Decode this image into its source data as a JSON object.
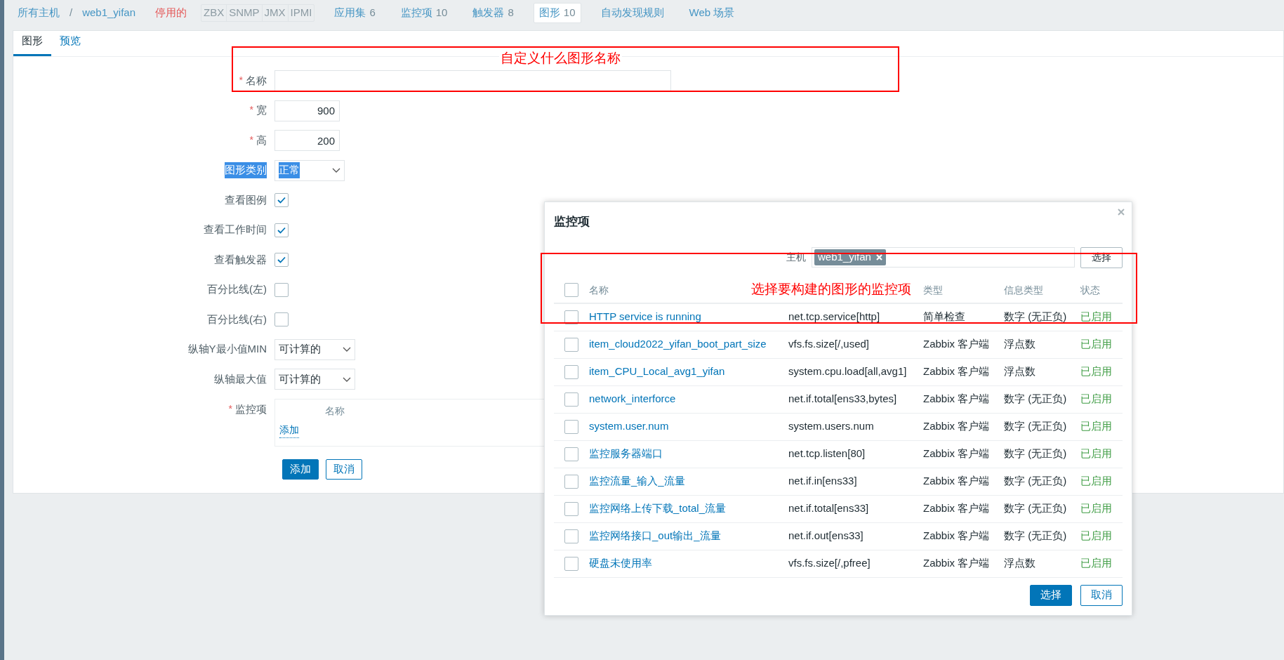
{
  "breadcrumb": {
    "host_list": "所有主机",
    "separator": "/",
    "host": "web1_yifan"
  },
  "host_status": "停用的",
  "availability": [
    "ZBX",
    "SNMP",
    "JMX",
    "IPMI"
  ],
  "nav_tabs": [
    {
      "label": "应用集",
      "count": "6",
      "selected": false
    },
    {
      "label": "监控项",
      "count": "10",
      "selected": false
    },
    {
      "label": "触发器",
      "count": "8",
      "selected": false
    },
    {
      "label": "图形",
      "count": "10",
      "selected": true
    },
    {
      "label": "自动发现规则",
      "selected": false
    },
    {
      "label": "Web 场景",
      "selected": false
    }
  ],
  "subtabs": [
    {
      "label": "图形",
      "selected": true
    },
    {
      "label": "预览",
      "selected": false
    }
  ],
  "form": {
    "required_mark": "*",
    "fields": [
      {
        "kind": "text",
        "label": "名称",
        "required": true
      },
      {
        "kind": "number",
        "label": "宽",
        "required": true,
        "value": "900"
      },
      {
        "kind": "number",
        "label": "高",
        "required": true,
        "value": "200"
      },
      {
        "kind": "select",
        "label": "图形类别",
        "value": "正常",
        "highlighted": true
      },
      {
        "kind": "checkbox",
        "label": "查看图例",
        "checked": true
      },
      {
        "kind": "checkbox",
        "label": "查看工作时间",
        "checked": true
      },
      {
        "kind": "checkbox",
        "label": "查看触发器",
        "checked": true
      },
      {
        "kind": "checkbox",
        "label": "百分比线(左)",
        "checked": false
      },
      {
        "kind": "checkbox",
        "label": "百分比线(右)",
        "checked": false
      },
      {
        "kind": "select",
        "label": "纵轴Y最小值MIN",
        "value": "可计算的",
        "highlighted": false
      },
      {
        "kind": "select",
        "label": "纵轴最大值",
        "value": "可计算的",
        "highlighted": false
      },
      {
        "kind": "items",
        "label": "监控项",
        "required": true,
        "column": "名称",
        "link": "添加"
      }
    ],
    "buttons": [
      {
        "label": "添加",
        "kind": "primary"
      },
      {
        "label": "取消",
        "kind": "secondary"
      }
    ]
  },
  "dialog": {
    "title": "监控项",
    "host_label": "主机",
    "host_tag": "web1_yifan",
    "select_button": "选择",
    "select_all": {
      "checked": false
    },
    "header": {
      "name": "名称",
      "type": "类型",
      "info_type": "信息类型",
      "status": "状态"
    },
    "rows": [
      {
        "name": "HTTP service is running",
        "key": "net.tcp.service[http]",
        "type": "简单检查",
        "info_type": "数字 (无正负)",
        "status": "已启用",
        "checked": false
      },
      {
        "name": "item_cloud2022_yifan_boot_part_size",
        "key": "vfs.fs.size[/,used]",
        "type": "Zabbix 客户端",
        "info_type": "浮点数",
        "status": "已启用",
        "checked": false
      },
      {
        "name": "item_CPU_Local_avg1_yifan",
        "key": "system.cpu.load[all,avg1]",
        "type": "Zabbix 客户端",
        "info_type": "浮点数",
        "status": "已启用",
        "checked": false
      },
      {
        "name": "network_interforce",
        "key": "net.if.total[ens33,bytes]",
        "type": "Zabbix 客户端",
        "info_type": "数字 (无正负)",
        "status": "已启用",
        "checked": false
      },
      {
        "name": "system.user.num",
        "key": "system.users.num",
        "type": "Zabbix 客户端",
        "info_type": "数字 (无正负)",
        "status": "已启用",
        "checked": false
      },
      {
        "name": "监控服务器端口",
        "key": "net.tcp.listen[80]",
        "type": "Zabbix 客户端",
        "info_type": "数字 (无正负)",
        "status": "已启用",
        "checked": false
      },
      {
        "name": "监控流量_输入_流量",
        "key": "net.if.in[ens33]",
        "type": "Zabbix 客户端",
        "info_type": "数字 (无正负)",
        "status": "已启用",
        "checked": false
      },
      {
        "name": "监控网络上传下载_total_流量",
        "key": "net.if.total[ens33]",
        "type": "Zabbix 客户端",
        "info_type": "数字 (无正负)",
        "status": "已启用",
        "checked": false
      },
      {
        "name": "监控网络接口_out输出_流量",
        "key": "net.if.out[ens33]",
        "type": "Zabbix 客户端",
        "info_type": "数字 (无正负)",
        "status": "已启用",
        "checked": false
      },
      {
        "name": "硬盘未使用率",
        "key": "vfs.fs.size[/,pfree]",
        "type": "Zabbix 客户端",
        "info_type": "浮点数",
        "status": "已启用",
        "checked": false
      }
    ],
    "buttons": [
      {
        "label": "选择",
        "kind": "primary"
      },
      {
        "label": "取消",
        "kind": "secondary"
      }
    ]
  },
  "annotations": [
    {
      "text": "自定义什么图形名称"
    },
    {
      "text": "选择要构建的图形的监控项"
    }
  ]
}
